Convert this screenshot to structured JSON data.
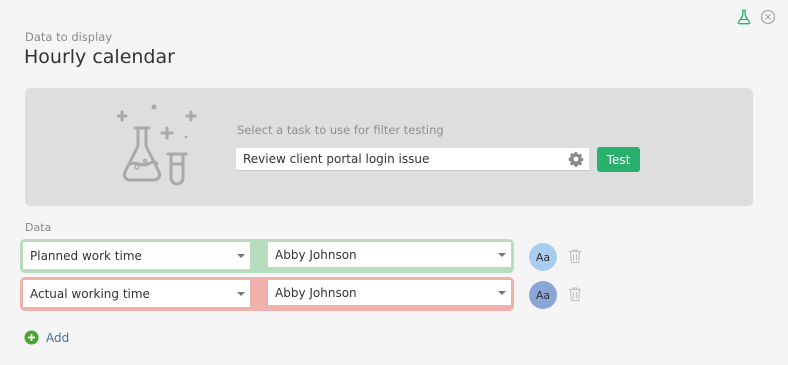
{
  "header": {
    "subtitle": "Data to display",
    "title": "Hourly calendar"
  },
  "filter_test": {
    "label": "Select a task to use for filter testing",
    "task_value": "Review client portal login issue",
    "test_button": "Test"
  },
  "data_section": {
    "label": "Data",
    "rows": [
      {
        "type": "Planned work time",
        "user": "Abby Johnson",
        "avatar": "Aa",
        "color": "#b8dcbe"
      },
      {
        "type": "Actual working time",
        "user": "Abby Johnson",
        "avatar": "Aa",
        "color": "#f0b1ad"
      }
    ],
    "add_label": "Add"
  },
  "colors": {
    "accent_green": "#27b16d",
    "link_blue": "#4a6ea8"
  },
  "icons": [
    "flask-icon",
    "close-icon",
    "flask-illustration",
    "gear-icon",
    "chevron-down-icon",
    "trash-icon",
    "add-icon"
  ]
}
